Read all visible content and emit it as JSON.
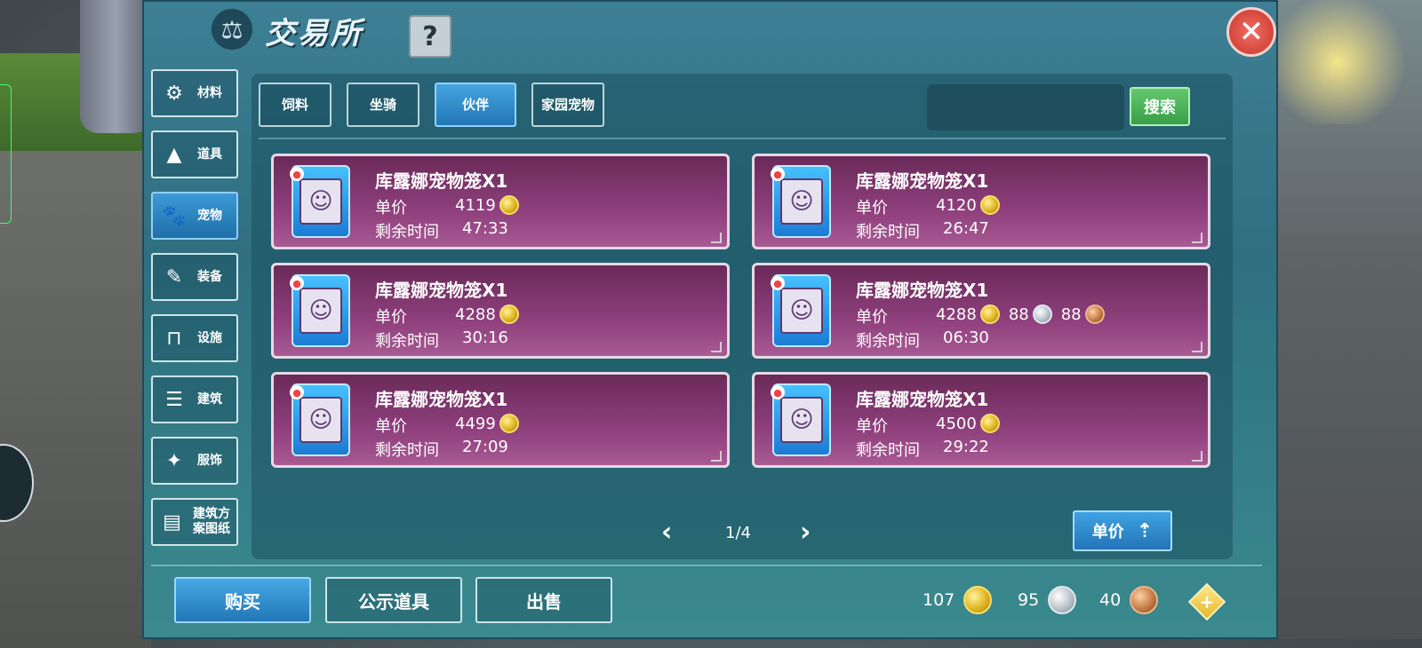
{
  "window": {
    "title": "交易所",
    "help_label": "?",
    "close_label": "✕"
  },
  "sidebar": {
    "items": [
      {
        "label": "材料",
        "icon": "material-icon",
        "glyph": "⚙",
        "active": false
      },
      {
        "label": "道具",
        "icon": "prop-icon",
        "glyph": "▲",
        "active": false
      },
      {
        "label": "宠物",
        "icon": "paw-icon",
        "glyph": "🐾",
        "active": true
      },
      {
        "label": "装备",
        "icon": "equipment-icon",
        "glyph": "✎",
        "active": false
      },
      {
        "label": "设施",
        "icon": "facility-icon",
        "glyph": "⊓",
        "active": false
      },
      {
        "label": "建筑",
        "icon": "building-icon",
        "glyph": "☰",
        "active": false
      },
      {
        "label": "服饰",
        "icon": "clothing-icon",
        "glyph": "✦",
        "active": false
      },
      {
        "label": "建筑方案图纸",
        "icon": "blueprint-icon",
        "glyph": "▤",
        "active": false
      }
    ]
  },
  "tabs": [
    {
      "label": "饲料",
      "active": false
    },
    {
      "label": "坐骑",
      "active": false
    },
    {
      "label": "伙伴",
      "active": true
    },
    {
      "label": "家园宠物",
      "active": false
    }
  ],
  "search": {
    "button_label": "搜索",
    "value": ""
  },
  "listing_labels": {
    "price": "单价",
    "time": "剩余时间"
  },
  "listings": [
    {
      "name": "库露娜宠物笼X1",
      "gold": "4119",
      "silver": "",
      "copper": "",
      "time": "47:33"
    },
    {
      "name": "库露娜宠物笼X1",
      "gold": "4120",
      "silver": "",
      "copper": "",
      "time": "26:47"
    },
    {
      "name": "库露娜宠物笼X1",
      "gold": "4288",
      "silver": "",
      "copper": "",
      "time": "30:16"
    },
    {
      "name": "库露娜宠物笼X1",
      "gold": "4288",
      "silver": "88",
      "copper": "88",
      "time": "06:30"
    },
    {
      "name": "库露娜宠物笼X1",
      "gold": "4499",
      "silver": "",
      "copper": "",
      "time": "27:09"
    },
    {
      "name": "库露娜宠物笼X1",
      "gold": "4500",
      "silver": "",
      "copper": "",
      "time": "29:22"
    }
  ],
  "pagination": {
    "text": "1/4",
    "prev": "‹",
    "next": "›"
  },
  "sort": {
    "label": "单价",
    "arrow": "⇡"
  },
  "bottom": {
    "buy": "购买",
    "public": "公示道具",
    "sell": "出售"
  },
  "currency": {
    "gold": "107",
    "silver": "95",
    "copper": "40",
    "add": "+"
  },
  "colors": {
    "panel": "#3d7f95",
    "card": "#8e3f7c",
    "accent": "#2f8fd0",
    "search": "#47b05a",
    "close": "#d9453a"
  }
}
